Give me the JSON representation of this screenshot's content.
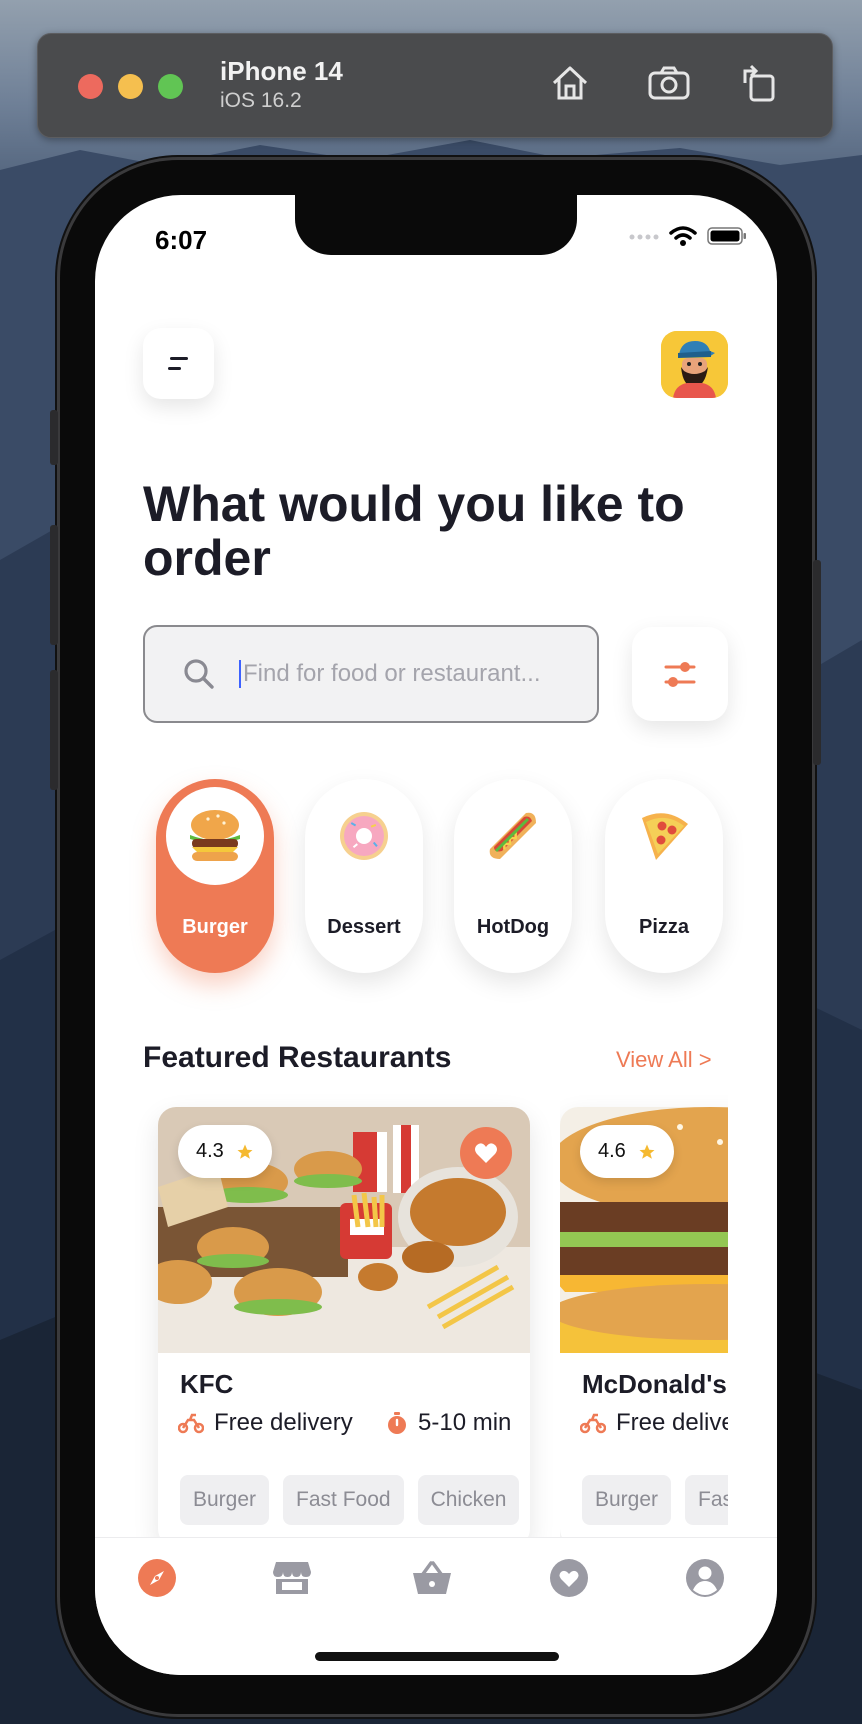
{
  "simulator": {
    "device_name": "iPhone 14",
    "os_version": "iOS 16.2",
    "buttons": [
      "home-icon",
      "screenshot-icon",
      "rotate-icon"
    ]
  },
  "status_bar": {
    "time": "6:07"
  },
  "header": {
    "menu_icon": "menu-icon",
    "avatar_icon": "avatar"
  },
  "headline": "What would you like to order",
  "search": {
    "placeholder": "Find for food or restaurant...",
    "value": ""
  },
  "categories": [
    {
      "label": "Burger",
      "icon": "burger-icon",
      "active": true
    },
    {
      "label": "Dessert",
      "icon": "donut-icon",
      "active": false
    },
    {
      "label": "HotDog",
      "icon": "hotdog-icon",
      "active": false
    },
    {
      "label": "Pizza",
      "icon": "pizza-icon",
      "active": false
    }
  ],
  "featured": {
    "title": "Featured Restaurants",
    "view_all": "View All >",
    "restaurants": [
      {
        "name": "KFC",
        "rating": "4.3",
        "favorite": true,
        "delivery": "Free delivery",
        "time": "5-10 min",
        "tags": [
          "Burger",
          "Fast Food",
          "Chicken"
        ]
      },
      {
        "name": "McDonald's",
        "rating": "4.6",
        "favorite": false,
        "delivery": "Free delivery",
        "time": "",
        "tags": [
          "Burger",
          "Fast Food"
        ]
      }
    ]
  },
  "tabbar": [
    "compass-icon",
    "store-icon",
    "basket-icon",
    "heart-icon",
    "profile-icon"
  ],
  "colors": {
    "accent": "#EE7A55",
    "text": "#1C1C27",
    "muted": "#8C8C94",
    "tag_bg": "#EFEFF1"
  }
}
